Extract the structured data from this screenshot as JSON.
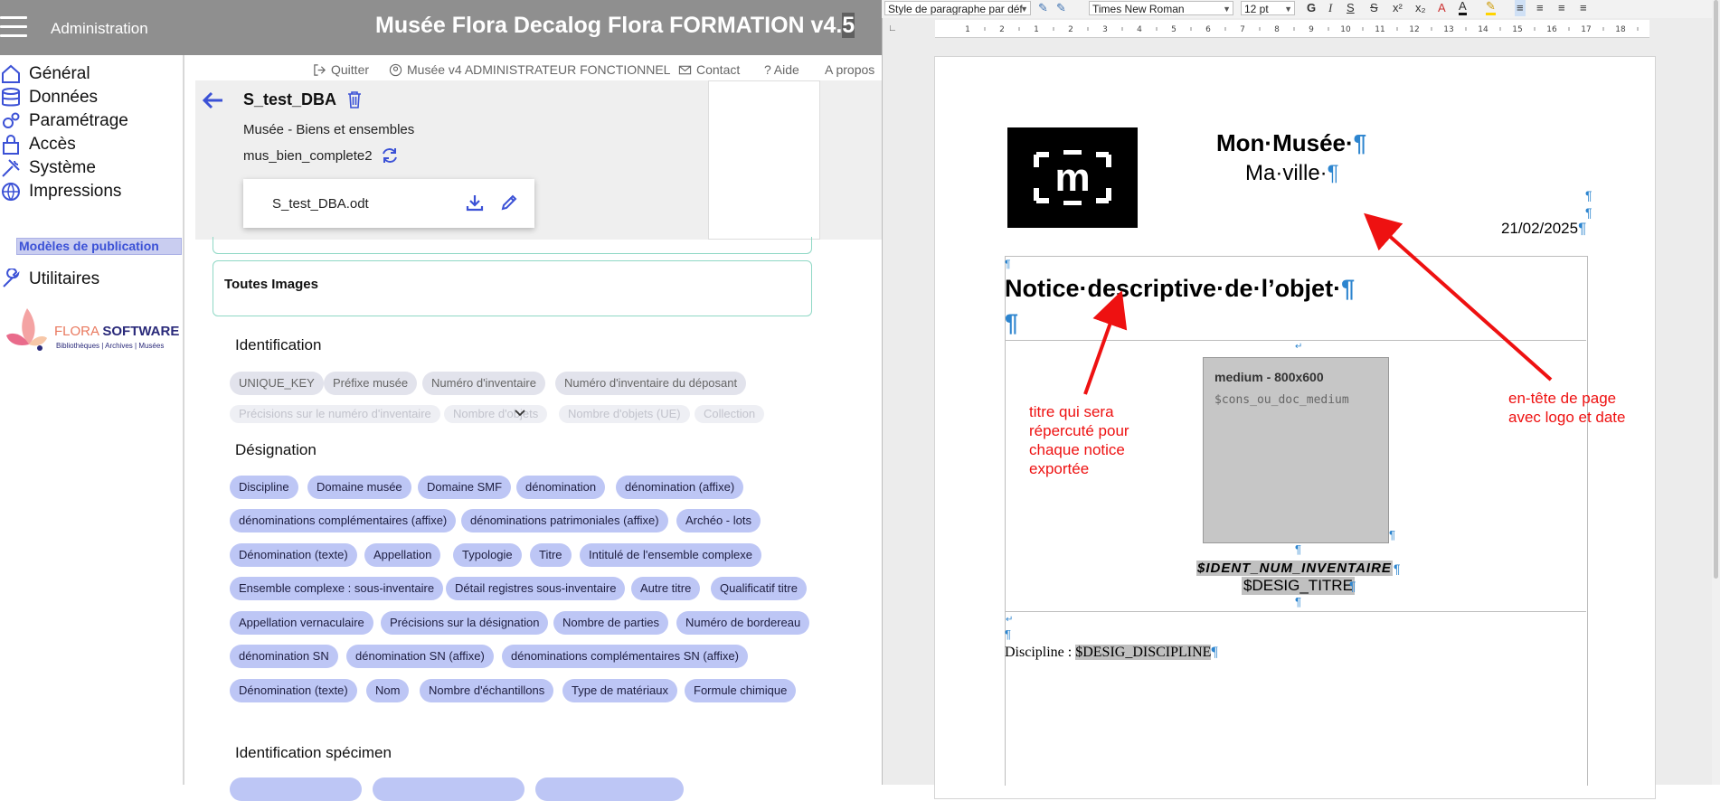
{
  "app": {
    "admin_label": "Administration",
    "title_main": "Musée Flora Decalog Flora FORMATION v4.",
    "title_sel": "5"
  },
  "sidebar": {
    "items": [
      {
        "label": "Général",
        "icon": "home-icon"
      },
      {
        "label": "Données",
        "icon": "database-icon"
      },
      {
        "label": "Paramétrage",
        "icon": "gears-icon"
      },
      {
        "label": "Accès",
        "icon": "lock-icon"
      },
      {
        "label": "Système",
        "icon": "tools-icon"
      },
      {
        "label": "Impressions",
        "icon": "globe-icon"
      },
      {
        "label": "Utilitaires",
        "icon": "wrench-icon"
      }
    ],
    "active_sub": "Modèles de publication",
    "logo_brand": "FLORA",
    "logo_brand2": "SOFTWARE",
    "logo_tagline": "Bibliothèques | Archives | Musées"
  },
  "header": {
    "quit": "Quitter",
    "user": "Musée v4 ADMINISTRATEUR FONCTIONNEL",
    "contact": "Contact",
    "help": "Aide",
    "about": "A propos"
  },
  "model": {
    "name": "S_test_DBA",
    "subtitle1": "Musée - Biens et ensembles",
    "subtitle2": "mus_bien_complete2",
    "file_name": "S_test_DBA.odt"
  },
  "content": {
    "images_title": "Toutes Images",
    "identification_title": "Identification",
    "identification_chips": [
      "UNIQUE_KEY",
      "Préfixe musée",
      "Numéro d'inventaire",
      "Numéro d'inventaire du déposant"
    ],
    "identification_faded": [
      "Précisions sur le numéro d'inventaire",
      "Nombre d'objets",
      "Nombre d'objets (UE)",
      "Collection"
    ],
    "designation_title": "Désignation",
    "designation_rows": [
      [
        "Discipline",
        "Domaine musée",
        "Domaine SMF",
        "dénomination",
        "dénomination (affixe)"
      ],
      [
        "dénominations complémentaires (affixe)",
        "dénominations patrimoniales (affixe)",
        "Archéo - lots"
      ],
      [
        "Dénomination (texte)",
        "Appellation",
        "Typologie",
        "Titre",
        "Intitulé de l'ensemble complexe"
      ],
      [
        "Ensemble complexe : sous-inventaire",
        "Détail registres sous-inventaire",
        "Autre titre",
        "Qualificatif titre"
      ],
      [
        "Appellation vernaculaire",
        "Précisions sur la désignation",
        "Nombre de parties",
        "Numéro de bordereau"
      ],
      [
        "dénomination SN",
        "dénomination SN (affixe)",
        "dénominations complémentaires SN (affixe)"
      ],
      [
        "Dénomination (texte)",
        "Nom",
        "Nombre d'échantillons",
        "Type de matériaux",
        "Formule chimique"
      ]
    ],
    "specimen_title": "Identification spécimen"
  },
  "editor": {
    "para_style": "Style de paragraphe par déf",
    "font_name": "Times New Roman",
    "font_size": "12 pt",
    "ruler_numbers": [
      "1",
      "2",
      "1",
      "2",
      "3",
      "4",
      "5",
      "6",
      "7",
      "8",
      "9",
      "10",
      "11",
      "12",
      "13",
      "14",
      "15",
      "16",
      "17",
      "18"
    ]
  },
  "document": {
    "logo_letter": "m",
    "museum": "Mon·Musée·",
    "city": "Ma·ville·",
    "date": "21/02/2025",
    "notice_title": "Notice·descriptive·de·l’objet·",
    "img_label": "medium - 800x600",
    "img_var": "$cons_ou_doc_medium",
    "ident_var": "$IDENT_NUM_INVENTAIRE",
    "desig_var": "$DESIG_TITRE",
    "discipline_label": "Discipline",
    "discipline_sep": " : ",
    "discipline_var": "$DESIG_DISCIPLINE",
    "pilcrow": "¶"
  },
  "annotations": {
    "title_note": [
      "titre qui sera",
      "répercuté pour",
      "chaque notice",
      "exportée"
    ],
    "header_note": [
      "en-tête de page",
      "avec logo et date"
    ]
  },
  "colors": {
    "accent_blue": "#3b51d6",
    "chip_blue": "#bdc6f5",
    "annotation_red": "#ee1111",
    "pilcrow_blue": "#2d85cf"
  }
}
